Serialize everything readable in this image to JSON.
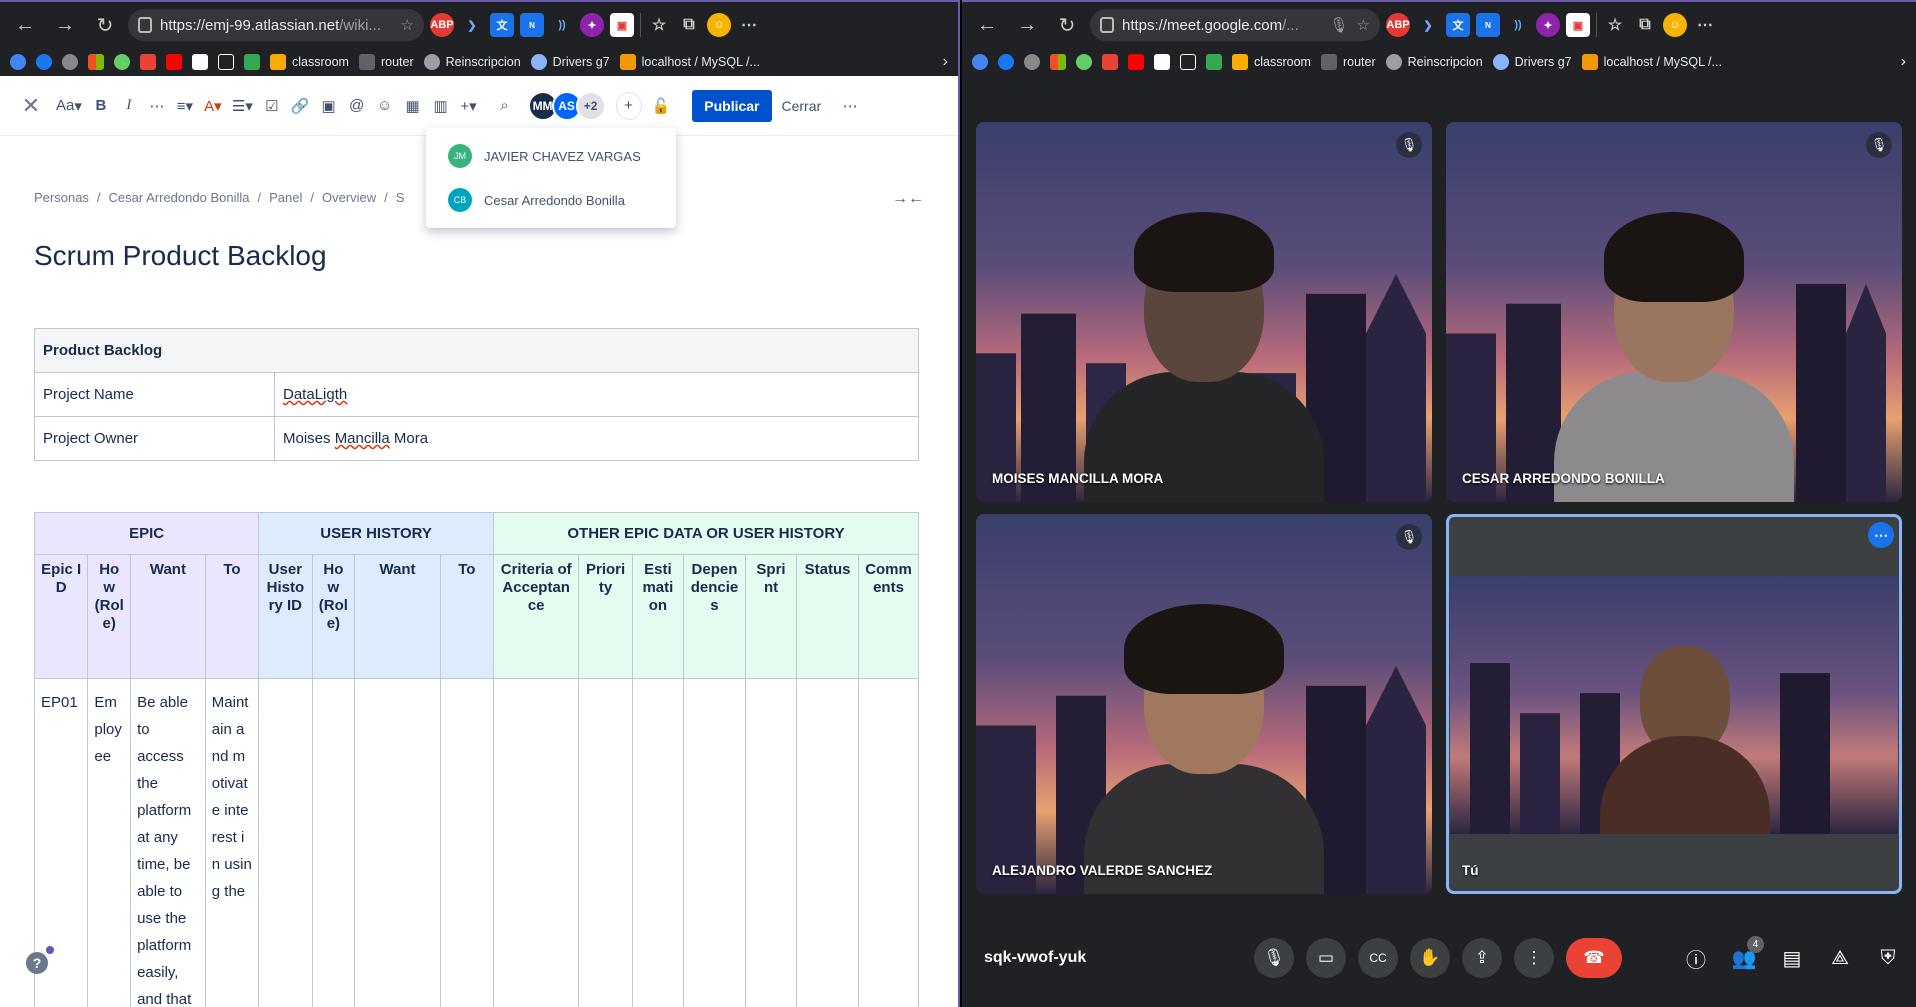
{
  "left_browser": {
    "url_main": "https://emj-99.atlassian.net",
    "url_rest": "/wiki...",
    "bookmarks": [
      {
        "label": "classroom",
        "color": "#f9ab00"
      },
      {
        "label": "router",
        "color": "#5f6368"
      },
      {
        "label": "Reinscripcion",
        "color": "#9aa0a6"
      },
      {
        "label": "Drivers g7",
        "color": "#8ab4f8"
      },
      {
        "label": "localhost / MySQL /...",
        "color": "#f29900"
      }
    ]
  },
  "editor": {
    "font_size_label": "Aa",
    "publish_label": "Publicar",
    "close_label": "Cerrar",
    "avatars": [
      {
        "initials": "MM",
        "color": "#172b4d"
      },
      {
        "initials": "AS",
        "color": "#0065ff"
      },
      {
        "initials": "+2",
        "color": "#dfe1e6"
      }
    ],
    "dropdown": [
      {
        "initials": "JM",
        "name": "JAVIER CHAVEZ VARGAS",
        "color": "#36b37e"
      },
      {
        "initials": "CB",
        "name": "Cesar Arredondo Bonilla",
        "color": "#00a3bf"
      }
    ],
    "breadcrumb": [
      "Personas",
      "/",
      "Cesar Arredondo Bonilla",
      "/",
      "Panel",
      "/",
      "Overview",
      "/",
      "S"
    ],
    "page_title": "Scrum Product Backlog",
    "info_table": {
      "header": "Product Backlog",
      "rows": [
        {
          "label": "Project Name",
          "value": "DataLigth"
        },
        {
          "label": "Project Owner",
          "value_a": "Moises ",
          "value_b": "Mancilla",
          "value_c": " Mora"
        }
      ]
    },
    "backlog": {
      "groups": [
        "EPIC",
        "USER HISTORY",
        "OTHER EPIC DATA OR USER HISTORY"
      ],
      "epic_cols": [
        "Epic ID",
        "How (Role)",
        "Want",
        "To"
      ],
      "uh_cols": [
        "User History ID",
        "How (Role)",
        "Want",
        "To"
      ],
      "other_cols": [
        "Criteria of Acceptance",
        "Priority",
        "Estimation",
        "Dependencies",
        "Sprint",
        "Status",
        "Comments"
      ],
      "row1": {
        "epic_id": "EP01",
        "role": "Employee",
        "want": "Be able to access the platform at any time, be able to use the platform easily, and that",
        "to": "Maintain and motivate interest in using the"
      }
    }
  },
  "right_browser": {
    "url_main": "https://meet.google.com",
    "url_rest": "/..."
  },
  "meet": {
    "tiles": [
      {
        "name": "MOISES MANCILLA MORA",
        "muted": true
      },
      {
        "name": "CESAR ARREDONDO BONILLA",
        "muted": true
      },
      {
        "name": "ALEJANDRO VALERDE SANCHEZ",
        "muted": true
      },
      {
        "name": "Tú",
        "muted": false
      }
    ],
    "meeting_code": "sqk-vwof-yuk",
    "participants_count": "4"
  }
}
